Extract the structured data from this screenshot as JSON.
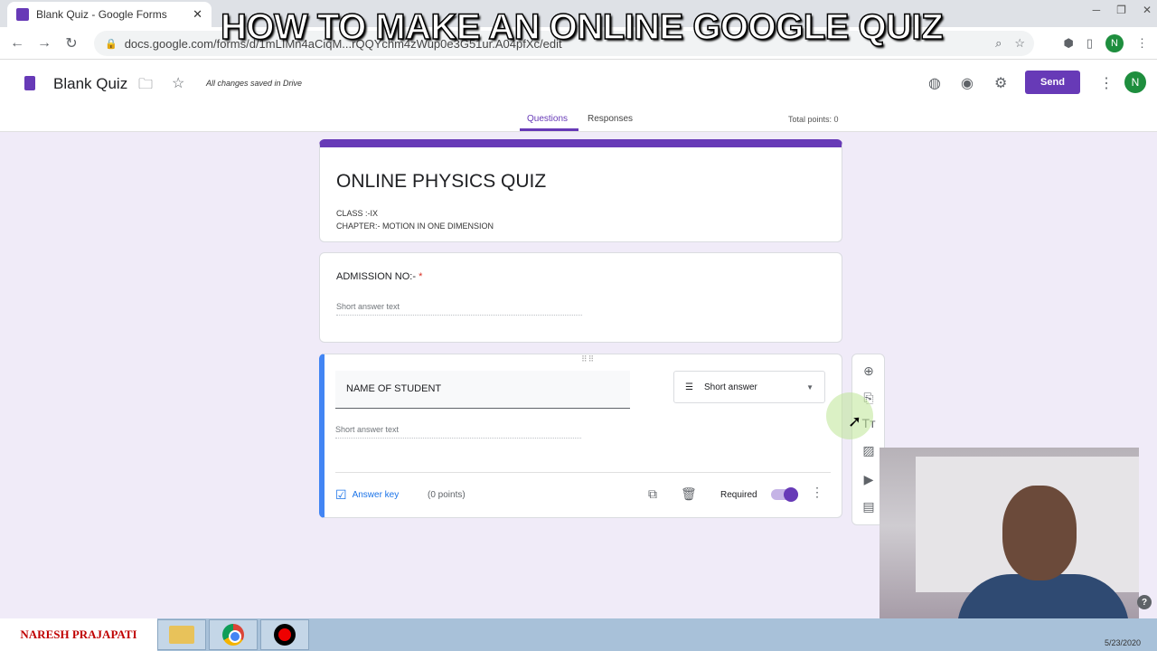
{
  "overlay_title": "HOW TO MAKE AN ONLINE GOOGLE QUIZ",
  "browser": {
    "tab_title": "Blank Quiz - Google Forms",
    "url": "docs.google.com/forms/d/1mLIMn4aCiqM...rQQYchm4zWup0e3G51ur.A04pfXc/edit",
    "profile_initial": "N"
  },
  "forms_header": {
    "doc_title": "Blank Quiz",
    "save_status": "All changes saved in Drive",
    "send_label": "Send",
    "avatar_initial": "N",
    "tabs": [
      {
        "label": "Questions",
        "active": true
      },
      {
        "label": "Responses",
        "active": false
      }
    ],
    "total_points": "Total points: 0"
  },
  "title_card": {
    "title": "ONLINE PHYSICS QUIZ",
    "desc_line1": "CLASS :-IX",
    "desc_line2": "CHAPTER:- MOTION IN ONE DIMENSION"
  },
  "question1": {
    "label": "ADMISSION NO:-",
    "required_mark": "*",
    "placeholder": "Short answer text"
  },
  "question2": {
    "label": "NAME OF STUDENT",
    "type": "Short answer",
    "placeholder": "Short answer text",
    "answer_key": "Answer key",
    "points": "(0 points)",
    "required_label": "Required",
    "required_on": true
  },
  "side_tools": [
    "add-question",
    "import-questions",
    "add-title",
    "add-image",
    "add-video",
    "add-section"
  ],
  "taskbar": {
    "brand": "NARESH PRAJAPATI",
    "date": "5/23/2020"
  },
  "colors": {
    "accent": "#673ab7",
    "background": "#f0ebf8",
    "active_border": "#4285f4"
  }
}
